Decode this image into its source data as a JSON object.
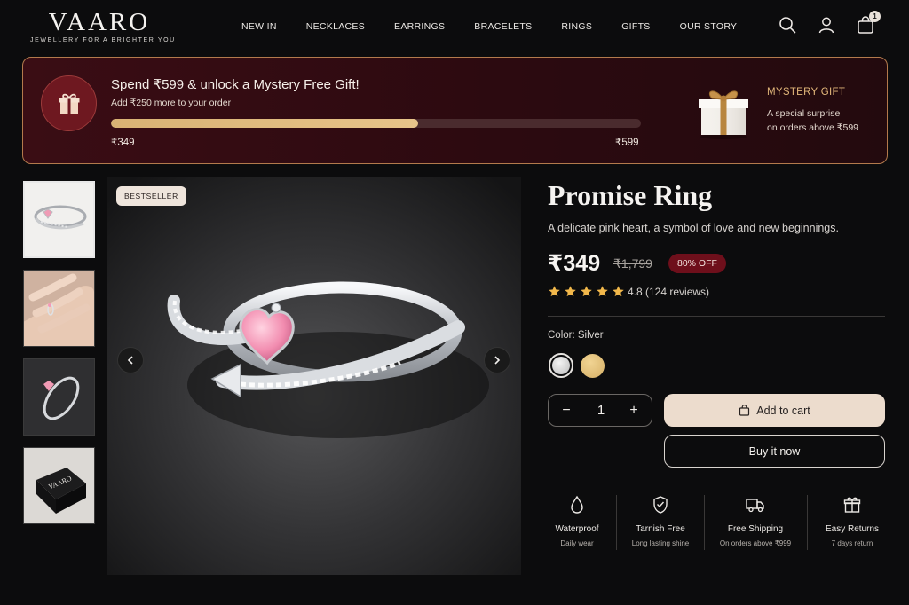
{
  "brand": {
    "name": "VAARO",
    "tagline": "JEWELLERY FOR A BRIGHTER YOU"
  },
  "nav": [
    "NEW IN",
    "NECKLACES",
    "EARRINGS",
    "BRACELETS",
    "RINGS",
    "GIFTS",
    "OUR STORY"
  ],
  "header_icons": {
    "search": "search-icon",
    "account": "user-icon",
    "cart": "shopping-bag-icon",
    "cart_count": "1"
  },
  "promo": {
    "title": "Spend ₹599 & unlock a Mystery Free Gift!",
    "subtitle": "Add ₹250 more to your order",
    "progress_fraction": 0.58,
    "progress_min_label": "₹349",
    "progress_max_label": "₹599",
    "mystery_title": "MYSTERY GIFT",
    "mystery_line1": "A special surprise",
    "mystery_line2": "on orders above ₹599"
  },
  "gallery": {
    "badge": "BESTSELLER",
    "thumbnails": [
      "ring-product-shot",
      "ring-on-hand",
      "ring-angle-view",
      "vaaro-gift-box"
    ],
    "box_logo": "VAARO"
  },
  "product": {
    "title": "Promise Ring",
    "description": "A delicate pink heart, a symbol of love and new beginnings.",
    "price": "₹349",
    "old_price": "₹1,799",
    "discount": "80% OFF",
    "rating_stars": 5,
    "rating_text": "4.8 (124 reviews)",
    "color_label": "Color: Silver",
    "colors": [
      {
        "name": "Silver",
        "hex": "#cfcfcf"
      },
      {
        "name": "Gold",
        "hex": "#e3c27d"
      }
    ],
    "quantity": "1",
    "qty_minus": "−",
    "qty_plus": "+",
    "add_to_cart": "Add to cart",
    "buy_now": "Buy it now"
  },
  "features": [
    {
      "icon": "water-drop-icon",
      "title": "Waterproof",
      "sub": "Daily wear"
    },
    {
      "icon": "shield-check-icon",
      "title": "Tarnish Free",
      "sub": "Long lasting shine"
    },
    {
      "icon": "truck-icon",
      "title": "Free Shipping",
      "sub": "On orders above ₹999"
    },
    {
      "icon": "gift-icon",
      "title": "Easy Returns",
      "sub": "7 days return"
    }
  ],
  "colors": {
    "accent_gold": "#e2b77a",
    "banner_bg": "#3a0d14",
    "cta_bg": "#ecdccd",
    "discount_bg": "#6e0f1b",
    "star": "#f2b84b"
  }
}
